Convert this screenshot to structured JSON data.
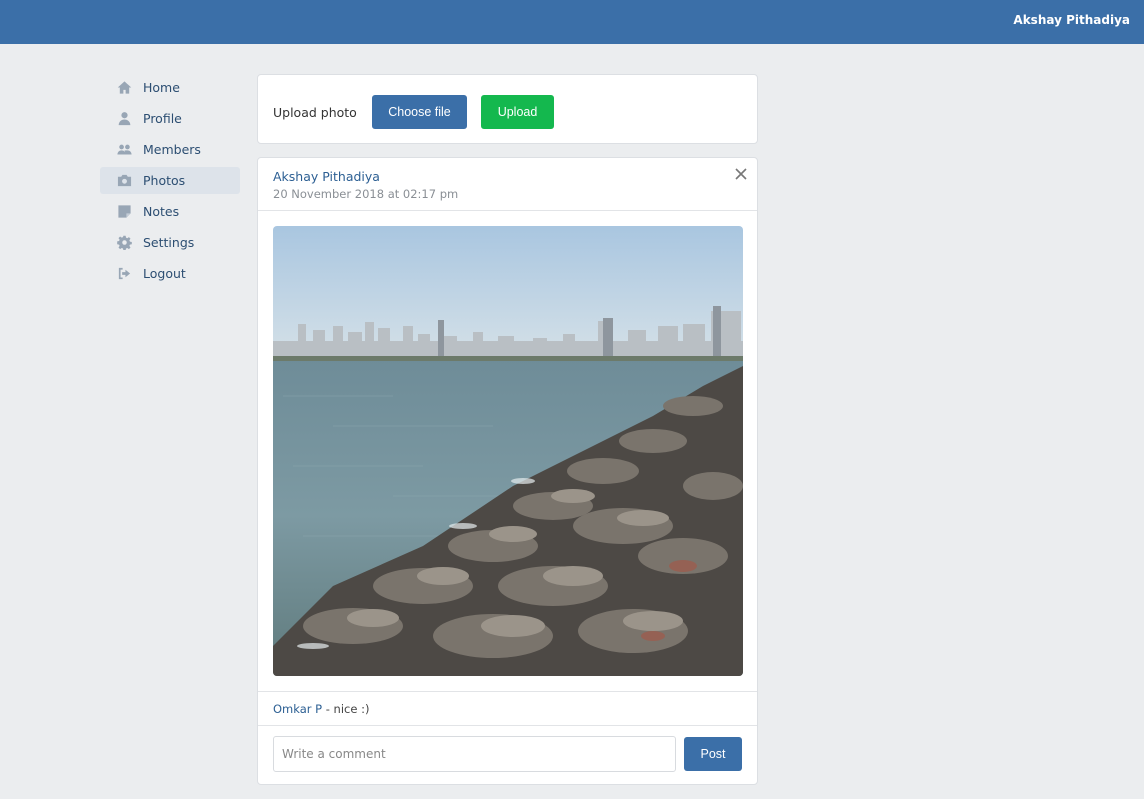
{
  "header": {
    "username": "Akshay Pithadiya"
  },
  "sidebar": {
    "items": [
      {
        "label": "Home",
        "icon": "home-icon"
      },
      {
        "label": "Profile",
        "icon": "user-icon"
      },
      {
        "label": "Members",
        "icon": "users-icon"
      },
      {
        "label": "Photos",
        "icon": "camera-icon",
        "active": true
      },
      {
        "label": "Notes",
        "icon": "note-icon"
      },
      {
        "label": "Settings",
        "icon": "gear-icon"
      },
      {
        "label": "Logout",
        "icon": "logout-icon"
      }
    ]
  },
  "upload": {
    "label": "Upload photo",
    "choose_label": "Choose file",
    "upload_label": "Upload"
  },
  "post": {
    "author": "Akshay Pithadiya",
    "date": "20 November 2018 at 02:17 pm",
    "comments": [
      {
        "author": "Omkar P",
        "text": " - nice :)"
      }
    ],
    "comment_placeholder": "Write a comment",
    "post_label": "Post"
  },
  "colors": {
    "brand": "#3b6fa8",
    "upload_button": "#14b84e",
    "background": "#ebedef",
    "link": "#2c5f93"
  }
}
